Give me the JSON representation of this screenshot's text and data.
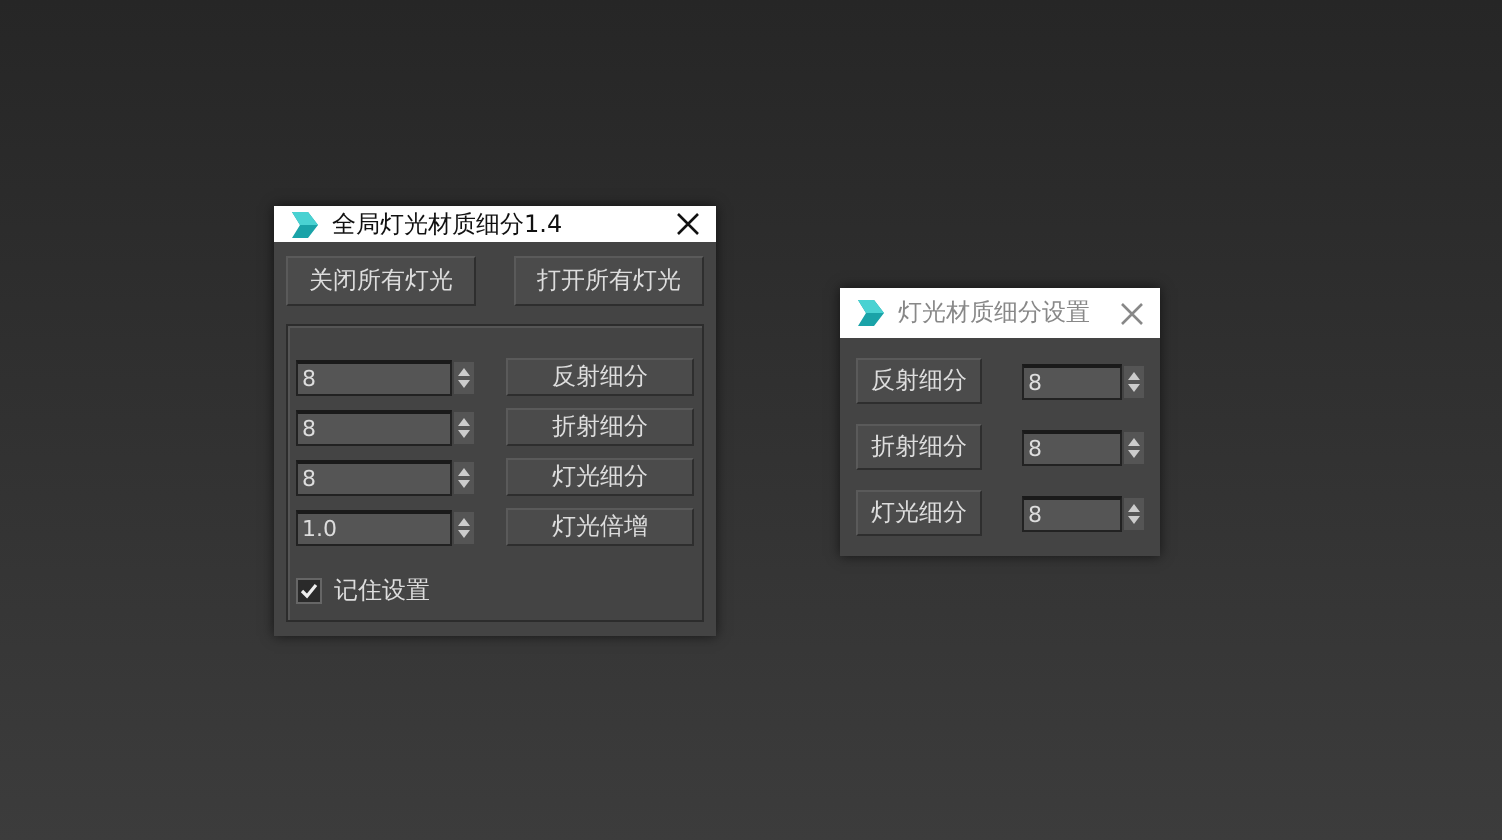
{
  "windows": [
    {
      "title": "全局灯光材质细分1.4",
      "active": true,
      "top_buttons": [
        "关闭所有灯光",
        "打开所有灯光"
      ],
      "rows": [
        {
          "value": "8",
          "button": "反射细分"
        },
        {
          "value": "8",
          "button": "折射细分"
        },
        {
          "value": "8",
          "button": "灯光细分"
        },
        {
          "value": "1.0",
          "button": "灯光倍增"
        }
      ],
      "remember": {
        "label": "记住设置",
        "checked": true
      }
    },
    {
      "title": "灯光材质细分设置",
      "active": false,
      "rows": [
        {
          "button": "反射细分",
          "value": "8"
        },
        {
          "button": "折射细分",
          "value": "8"
        },
        {
          "button": "灯光细分",
          "value": "8"
        }
      ]
    }
  ]
}
